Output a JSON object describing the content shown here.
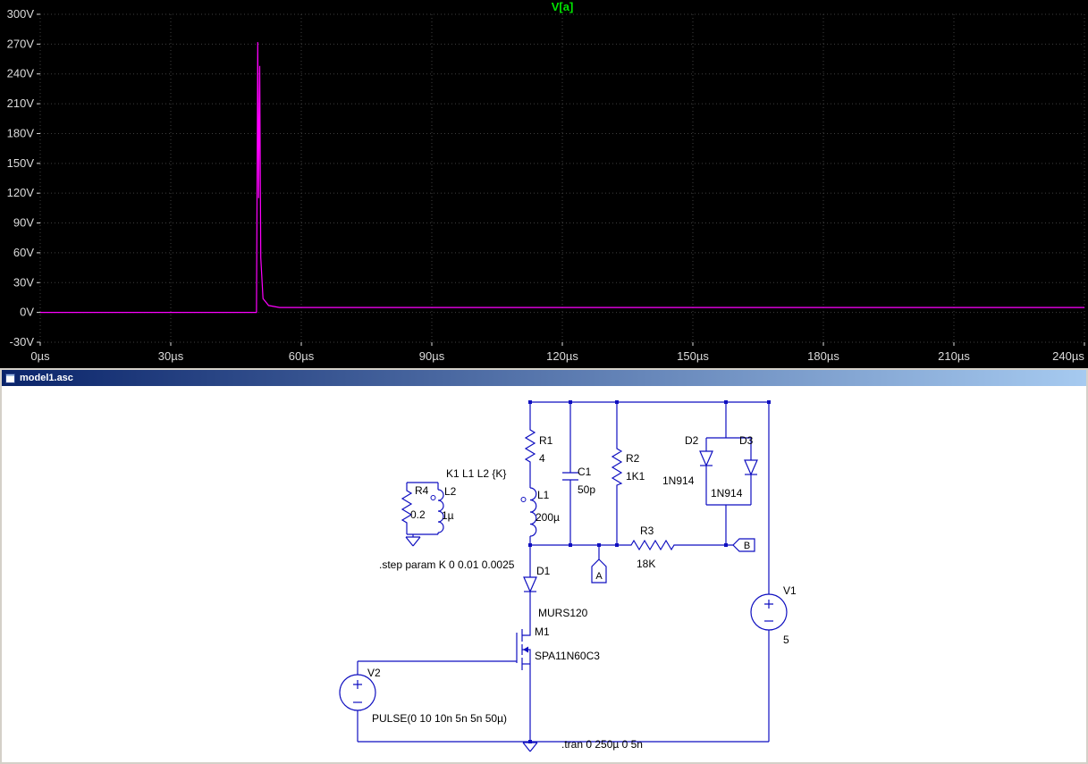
{
  "window": {
    "title": "model1.asc"
  },
  "colors": {
    "wire": "#0f0fc0",
    "grid": "#3f3f3f",
    "axis_text": "#dcdcdc",
    "plot_title": "#00e400",
    "trace": "#ff00ff",
    "titlebar_start": "#0a246a",
    "titlebar_end": "#a6caf0",
    "frame": "#d4d0c8",
    "plot_bg": "#000000",
    "schematic_bg": "#ffffff",
    "label_text": "#000000"
  },
  "chart_data": {
    "type": "line",
    "title": "V[a]",
    "x_unit": "µs",
    "y_unit": "V",
    "grid": true,
    "xlim": [
      0,
      240
    ],
    "ylim": [
      -30,
      300
    ],
    "x_tick_labels": [
      "0µs",
      "30µs",
      "60µs",
      "90µs",
      "120µs",
      "150µs",
      "180µs",
      "210µs",
      "240µs"
    ],
    "x_tick_values": [
      0,
      30,
      60,
      90,
      120,
      150,
      180,
      210,
      240
    ],
    "y_tick_labels": [
      "300V",
      "270V",
      "240V",
      "210V",
      "180V",
      "150V",
      "120V",
      "90V",
      "60V",
      "30V",
      "0V",
      "-30V"
    ],
    "y_tick_values": [
      300,
      270,
      240,
      210,
      180,
      150,
      120,
      90,
      60,
      30,
      0,
      -30
    ],
    "series": [
      {
        "name": "V[a]",
        "color": "#ff00ff",
        "points": [
          [
            0,
            0
          ],
          [
            49.7,
            0
          ],
          [
            50,
            272
          ],
          [
            50.2,
            115
          ],
          [
            50.45,
            248
          ],
          [
            50.7,
            55
          ],
          [
            51.2,
            14
          ],
          [
            52.5,
            7
          ],
          [
            55,
            5
          ],
          [
            240,
            5
          ]
        ]
      }
    ]
  },
  "schematic": {
    "net_labels": {
      "a": "A",
      "b": "B"
    },
    "directives": {
      "coupling": "K1 L1 L2 {K}",
      "step": ".step param K 0 0.01 0.0025",
      "tran": ".tran 0 250µ 0 5n"
    },
    "components": {
      "R1": {
        "name": "R1",
        "value": "4"
      },
      "C1": {
        "name": "C1",
        "value": "50p"
      },
      "R2": {
        "name": "R2",
        "value": "1K1"
      },
      "R3": {
        "name": "R3",
        "value": "18K"
      },
      "R4": {
        "name": "R4",
        "value": "0.2"
      },
      "L1": {
        "name": "L1",
        "value": "200µ"
      },
      "L2": {
        "name": "L2",
        "value": "1µ"
      },
      "D1": {
        "name": "D1",
        "value": "MURS120"
      },
      "D2": {
        "name": "D2",
        "value": "1N914"
      },
      "D3": {
        "name": "D3",
        "value": "1N914"
      },
      "M1": {
        "name": "M1",
        "value": "SPA11N60C3"
      },
      "V1": {
        "name": "V1",
        "value": "5"
      },
      "V2": {
        "name": "V2",
        "value": "PULSE(0 10 10n 5n 5n 50µ)"
      }
    }
  }
}
